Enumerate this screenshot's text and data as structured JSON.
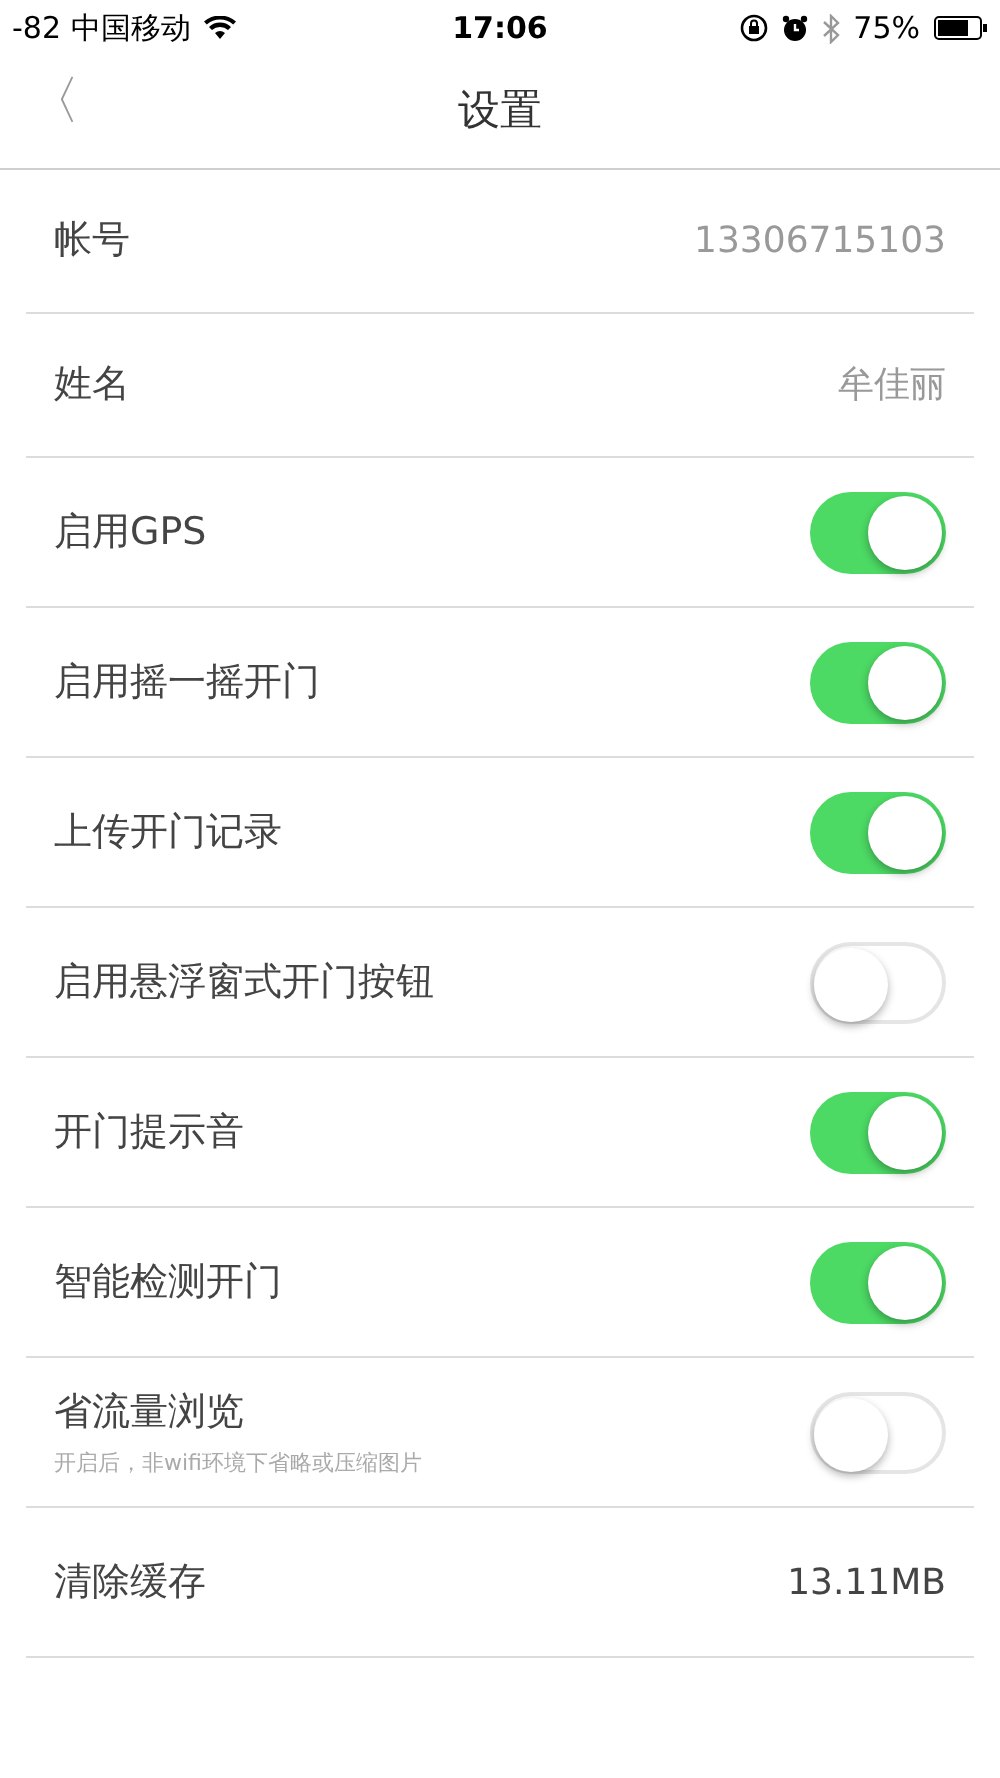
{
  "status_bar": {
    "signal": "-82",
    "carrier": "中国移动",
    "time": "17:06",
    "battery": "75%"
  },
  "nav": {
    "back": "〈",
    "title": "设置"
  },
  "rows": [
    {
      "kind": "value",
      "label": "帐号",
      "value": "13306715103"
    },
    {
      "kind": "value",
      "label": "姓名",
      "value": "牟佳丽"
    },
    {
      "kind": "toggle",
      "label": "启用GPS",
      "on": true
    },
    {
      "kind": "toggle",
      "label": "启用摇一摇开门",
      "on": true
    },
    {
      "kind": "toggle",
      "label": "上传开门记录",
      "on": true
    },
    {
      "kind": "toggle",
      "label": "启用悬浮窗式开门按钮",
      "on": false
    },
    {
      "kind": "toggle",
      "label": "开门提示音",
      "on": true
    },
    {
      "kind": "toggle",
      "label": "智能检测开门",
      "on": true
    },
    {
      "kind": "toggle",
      "label": "省流量浏览",
      "subtitle": "开启后，非wifi环境下省略或压缩图片",
      "on": false
    },
    {
      "kind": "value",
      "label": "清除缓存",
      "value": "13.11MB",
      "value_dark": true
    }
  ]
}
